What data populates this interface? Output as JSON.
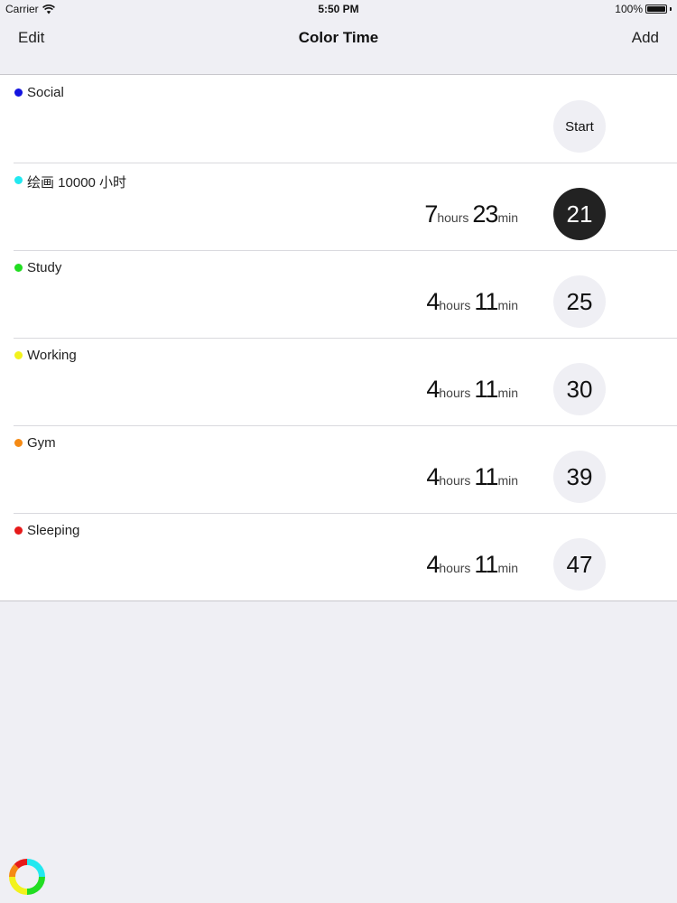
{
  "status": {
    "carrier": "Carrier",
    "time": "5:50 PM",
    "battery": "100%"
  },
  "nav": {
    "left": "Edit",
    "title": "Color Time",
    "right": "Add"
  },
  "rows": [
    {
      "name": "Social",
      "color": "#1414e0",
      "button": "Start"
    },
    {
      "name": "绘画 10000 小时",
      "color": "#22e8f0",
      "hours": "7",
      "hours_unit": "hours",
      "minutes": "23",
      "minutes_unit": "min",
      "button": "21"
    },
    {
      "name": "Study",
      "color": "#22dd22",
      "hours": "4",
      "hours_unit": "hours",
      "minutes": "11",
      "minutes_unit": "min",
      "button": "25"
    },
    {
      "name": "Working",
      "color": "#f2f21c",
      "hours": "4",
      "hours_unit": "hours",
      "minutes": "11",
      "minutes_unit": "min",
      "button": "30"
    },
    {
      "name": "Gym",
      "color": "#f58a14",
      "hours": "4",
      "hours_unit": "hours",
      "minutes": "11",
      "minutes_unit": "min",
      "button": "39"
    },
    {
      "name": "Sleeping",
      "color": "#e61a1a",
      "hours": "4",
      "hours_unit": "hours",
      "minutes": "11",
      "minutes_unit": "min",
      "button": "47"
    }
  ],
  "colors": {
    "active_button": "#222222",
    "button_bg": "#efeff4",
    "background": "#efeff4"
  },
  "icons": {
    "app_logo": "color-ring-logo"
  }
}
